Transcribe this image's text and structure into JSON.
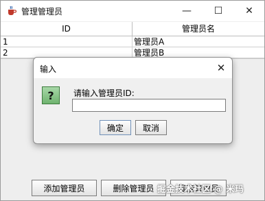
{
  "window": {
    "title": "管理管理员",
    "icon": "java-cup-icon",
    "controls": {
      "minimize": "—",
      "maximize": "☐",
      "close": "✕"
    }
  },
  "table": {
    "columns": [
      "ID",
      "管理员名"
    ],
    "rows": [
      [
        "1",
        "管理员A"
      ],
      [
        "2",
        "管理员B"
      ]
    ]
  },
  "buttons": {
    "add": "添加管理员",
    "delete": "删除管理员",
    "search": "搜索管理员"
  },
  "watermark": "掘金技术社区 @ 米玛",
  "dialog": {
    "title": "输入",
    "close": "✕",
    "icon_glyph": "?",
    "prompt": "请输入管理员ID:",
    "input_value": "",
    "ok": "确定",
    "cancel": "取消"
  }
}
